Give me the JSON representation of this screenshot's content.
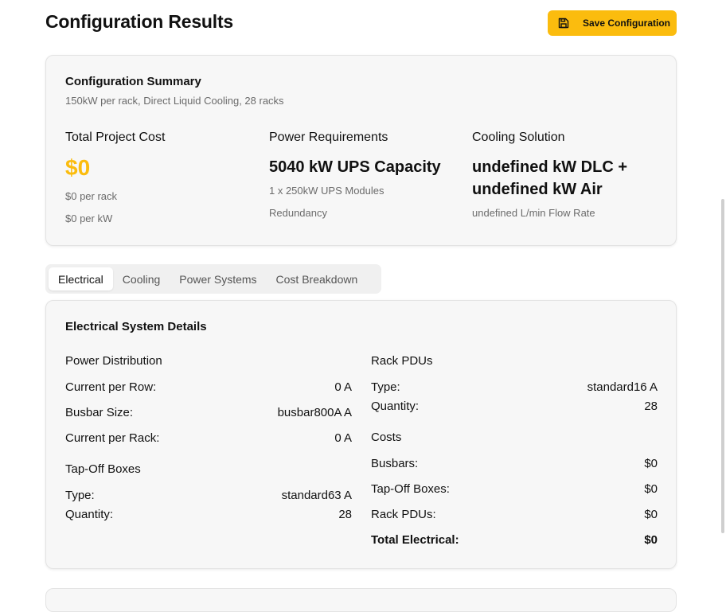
{
  "header": {
    "title": "Configuration Results",
    "save_label": "Save Configuration"
  },
  "summary": {
    "title": "Configuration Summary",
    "subtitle": "150kW per rack, Direct Liquid Cooling, 28 racks",
    "total_cost": {
      "label": "Total Project Cost",
      "value": "$0",
      "per_rack": "$0 per rack",
      "per_kw": "$0 per kW"
    },
    "power": {
      "label": "Power Requirements",
      "value": "5040 kW UPS Capacity",
      "modules": "1 x 250kW UPS Modules",
      "redundancy": "Redundancy"
    },
    "cooling": {
      "label": "Cooling Solution",
      "value_line1": "undefined kW DLC +",
      "value_line2": "undefined kW Air",
      "flow": "undefined L/min Flow Rate"
    }
  },
  "tabs": [
    {
      "label": "Electrical",
      "active": true
    },
    {
      "label": "Cooling",
      "active": false
    },
    {
      "label": "Power Systems",
      "active": false
    },
    {
      "label": "Cost Breakdown",
      "active": false
    }
  ],
  "electrical": {
    "title": "Electrical System Details",
    "power_distribution": {
      "heading": "Power Distribution",
      "rows": [
        {
          "label": "Current per Row:",
          "value": "0 A"
        },
        {
          "label": "Busbar Size:",
          "value": "busbar800A A"
        },
        {
          "label": "Current per Rack:",
          "value": "0 A"
        }
      ]
    },
    "tap_off": {
      "heading": "Tap-Off Boxes",
      "rows": [
        {
          "label": "Type:",
          "value": "standard63 A"
        },
        {
          "label": "Quantity:",
          "value": "28"
        }
      ]
    },
    "rack_pdus": {
      "heading": "Rack PDUs",
      "rows": [
        {
          "label": "Type:",
          "value": "standard16 A"
        },
        {
          "label": "Quantity:",
          "value": "28"
        }
      ]
    },
    "costs": {
      "heading": "Costs",
      "rows": [
        {
          "label": "Busbars:",
          "value": "$0"
        },
        {
          "label": "Tap-Off Boxes:",
          "value": "$0"
        },
        {
          "label": "Rack PDUs:",
          "value": "$0"
        },
        {
          "label": "Total Electrical:",
          "value": "$0"
        }
      ]
    }
  },
  "colors": {
    "accent": "#fbbc0e",
    "card_bg": "#f7f7f7",
    "muted_text": "#6b6b6b"
  }
}
